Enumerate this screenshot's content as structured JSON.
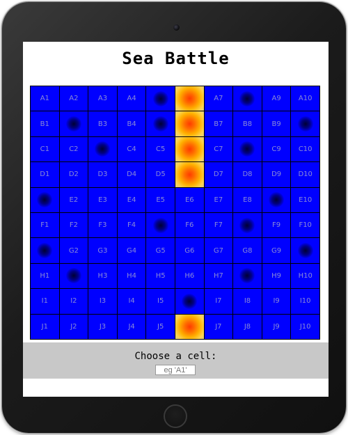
{
  "title": "Sea Battle",
  "prompt": "Choose a cell:",
  "input": {
    "placeholder": "eg 'A1'",
    "value": ""
  },
  "colors": {
    "water": "#0000ff",
    "grid_line": "#000000",
    "footer": "#c8c8c8"
  },
  "board": {
    "rows": [
      "A",
      "B",
      "C",
      "D",
      "E",
      "F",
      "G",
      "H",
      "I",
      "J"
    ],
    "cols": [
      "1",
      "2",
      "3",
      "4",
      "5",
      "6",
      "7",
      "8",
      "9",
      "10"
    ],
    "hits": [
      "A6",
      "B6",
      "C6",
      "D6",
      "J6"
    ],
    "misses": [
      "A5",
      "A8",
      "B2",
      "B5",
      "B10",
      "C3",
      "C8",
      "E1",
      "E9",
      "F5",
      "F8",
      "G1",
      "G10",
      "H2",
      "H8",
      "I6"
    ]
  }
}
